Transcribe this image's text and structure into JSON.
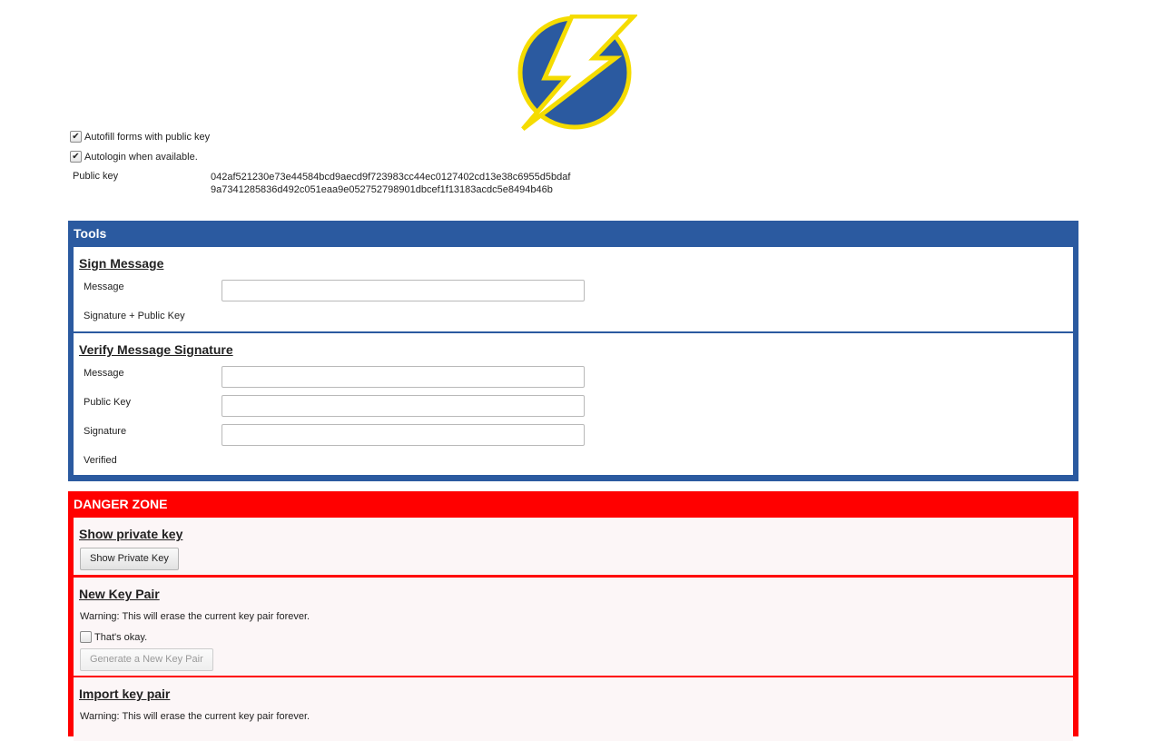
{
  "options": {
    "autofill_label": "Autofill forms with public key",
    "autofill_checked": true,
    "autologin_label": "Autologin when available.",
    "autologin_checked": true
  },
  "public_key": {
    "label": "Public key",
    "value": "042af521230e73e44584bcd9aecd9f723983cc44ec0127402cd13e38c6955d5bdaf9a7341285836d492c051eaa9e052752798901dbcef1f13183acdc5e8494b46b"
  },
  "tools": {
    "title": "Tools",
    "sign": {
      "title": "Sign Message",
      "message_label": "Message",
      "message_value": "",
      "sig_label": "Signature + Public Key"
    },
    "verify": {
      "title": "Verify Message Signature",
      "message_label": "Message",
      "message_value": "",
      "pubkey_label": "Public Key",
      "pubkey_value": "",
      "signature_label": "Signature",
      "signature_value": "",
      "verified_label": "Verified"
    }
  },
  "danger": {
    "title": "DANGER ZONE",
    "show_private": {
      "title": "Show private key",
      "button": "Show Private Key"
    },
    "new_pair": {
      "title": "New Key Pair",
      "warning": "Warning: This will erase the current key pair forever.",
      "confirm_label": "That's okay.",
      "confirm_checked": false,
      "button": "Generate a New Key Pair"
    },
    "import_pair": {
      "title": "Import key pair",
      "warning": "Warning: This will erase the current key pair forever."
    }
  },
  "colors": {
    "tools_blue": "#2b5aa0",
    "danger_red": "#ff0000",
    "logo_yellow": "#f5dc00"
  }
}
